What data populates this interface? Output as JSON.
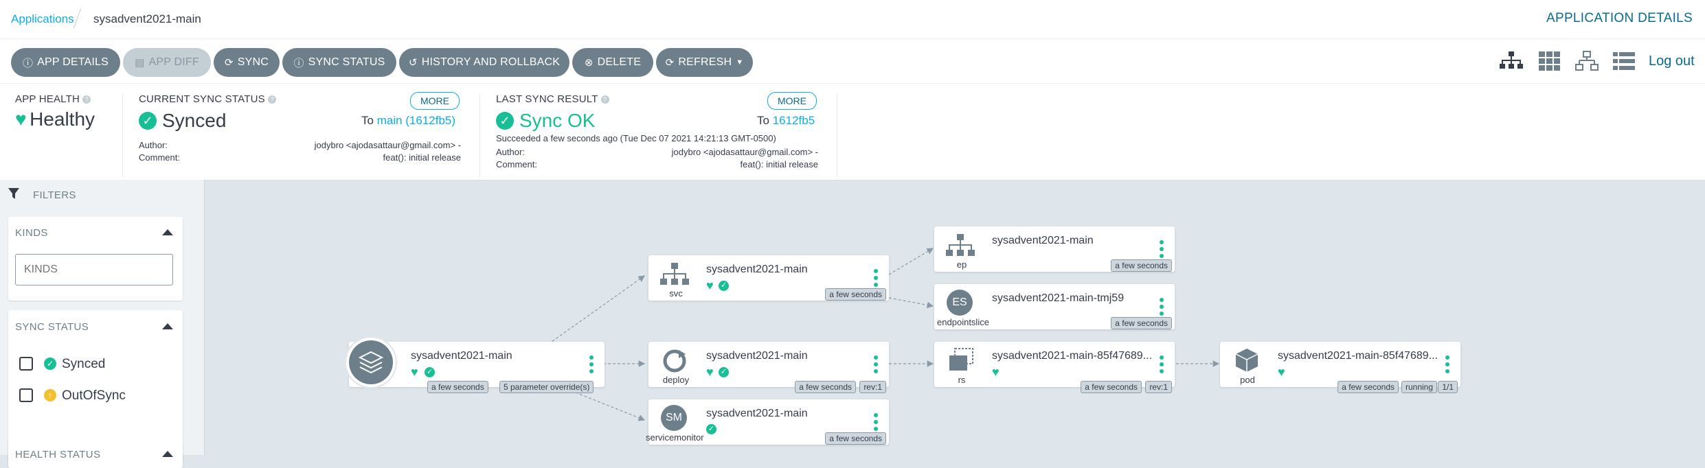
{
  "breadcrumb": {
    "parent": "Applications",
    "current": "sysadvent2021-main"
  },
  "header": {
    "title": "APPLICATION DETAILS"
  },
  "toolbar": {
    "app_details": "APP DETAILS",
    "app_diff": "APP DIFF",
    "sync": "SYNC",
    "sync_status": "SYNC STATUS",
    "history": "HISTORY AND ROLLBACK",
    "delete": "DELETE",
    "refresh": "REFRESH",
    "logout": "Log out"
  },
  "status": {
    "health_label": "APP HEALTH",
    "health_value": "Healthy",
    "sync_label": "CURRENT SYNC STATUS",
    "sync_value": "Synced",
    "sync_to_prefix": "To",
    "sync_to_ref": "main (1612fb5)",
    "more": "MORE",
    "author_label": "Author:",
    "comment_label": "Comment:",
    "author_value": "jodybro <ajodasattaur@gmail.com> -",
    "comment_value": "feat(): initial release",
    "last_label": "LAST SYNC RESULT",
    "last_value": "Sync OK",
    "last_to_prefix": "To",
    "last_to_ref": "1612fb5",
    "succeeded": "Succeeded a few seconds ago (Tue Dec 07 2021 14:21:13 GMT-0500)"
  },
  "filters": {
    "title": "FILTERS",
    "kinds_title": "KINDS",
    "kinds_placeholder": "KINDS",
    "sync_title": "SYNC STATUS",
    "synced": "Synced",
    "outofsync": "OutOfSync",
    "health_title": "HEALTH STATUS"
  },
  "nodes": {
    "app": {
      "name": "sysadvent2021-main",
      "age": "a few seconds",
      "overrides": "5 parameter override(s)"
    },
    "svc": {
      "name": "sysadvent2021-main",
      "kind": "svc",
      "age": "a few seconds"
    },
    "deploy": {
      "name": "sysadvent2021-main",
      "kind": "deploy",
      "age": "a few seconds",
      "rev": "rev:1"
    },
    "servicemonitor": {
      "name": "sysadvent2021-main",
      "kind": "servicemonitor",
      "age": "a few seconds",
      "abbr": "SM"
    },
    "ep": {
      "name": "sysadvent2021-main",
      "kind": "ep",
      "age": "a few seconds"
    },
    "endpointslice": {
      "name": "sysadvent2021-main-tmj59",
      "kind": "endpointslice",
      "age": "a few seconds",
      "abbr": "ES"
    },
    "rs": {
      "name": "sysadvent2021-main-85f47689...",
      "kind": "rs",
      "age": "a few seconds",
      "rev": "rev:1"
    },
    "pod": {
      "name": "sysadvent2021-main-85f47689...",
      "kind": "pod",
      "age": "a few seconds",
      "state": "running",
      "ready": "1/1"
    }
  },
  "colors": {
    "accent": "#0dadea",
    "healthy": "#18be94",
    "button": "#6d7f8b",
    "warning": "#f4c030"
  }
}
